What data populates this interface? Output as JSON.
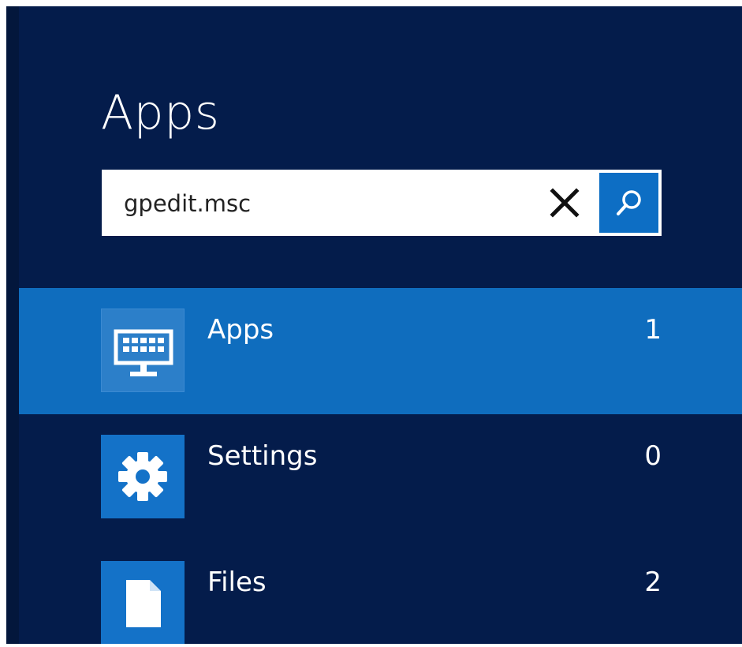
{
  "header": {
    "title": "Apps"
  },
  "search": {
    "value": "gpedit.msc",
    "placeholder": ""
  },
  "categories": [
    {
      "label": "Apps",
      "count": "1",
      "icon": "apps-monitor-icon",
      "selected": true
    },
    {
      "label": "Settings",
      "count": "0",
      "icon": "gear-icon",
      "selected": false
    },
    {
      "label": "Files",
      "count": "2",
      "icon": "file-icon",
      "selected": false
    }
  ],
  "colors": {
    "background": "#041c4b",
    "selected_row": "#0f6dbe",
    "tile": "#1472c8",
    "search_button": "#0d6ec4"
  }
}
